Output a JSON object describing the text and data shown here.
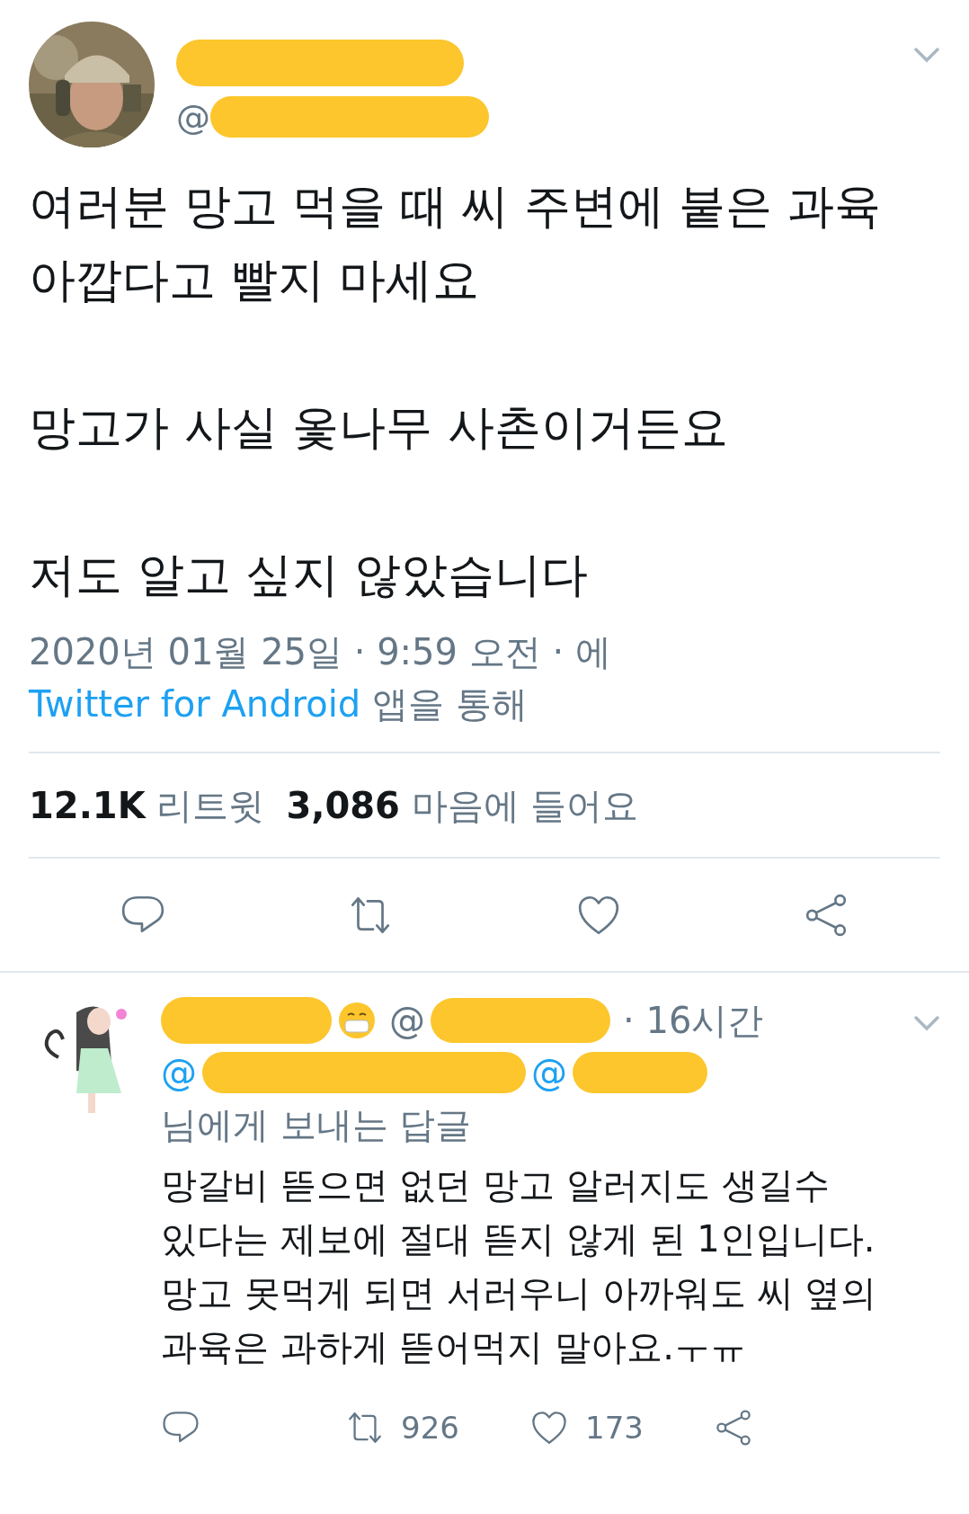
{
  "tweet": {
    "author": {
      "handle_prefix": "@"
    },
    "paragraphs": [
      "여러분 망고 먹을 때 씨 주변에 붙은 과육 아깝다고 빨지 마세요",
      "망고가 사실 옻나무 사촌이거든요",
      "저도 알고 싶지 않았습니다"
    ],
    "meta": {
      "time": "2020년 01월 25일 · 9:59 오전 · 에 ",
      "source": "Twitter for Android",
      "suffix": " 앱을 통해"
    },
    "stats": [
      {
        "count": "12.1K",
        "label": "리트윗"
      },
      {
        "count": "3,086",
        "label": "마음에 들어요"
      }
    ],
    "actions": [
      {
        "kind": "reply"
      },
      {
        "kind": "retweet"
      },
      {
        "kind": "like"
      },
      {
        "kind": "share"
      }
    ]
  },
  "reply": {
    "handle_prefix": "@",
    "time": "· 16시간",
    "mentions": [
      "@",
      "@"
    ],
    "reply_to_suffix": "님에게 보내는 답글",
    "text": "망갈비 뜯으면 없던 망고 알러지도 생길수 있다는 제보에 절대 뜯지 않게 된 1인입니다. 망고 못먹게 되면 서러우니 아까워도 씨 옆의 과육은 과하게 뜯어먹지 말아요.ㅜㅠ",
    "actions": [
      {
        "kind": "reply"
      },
      {
        "kind": "retweet",
        "count": "926"
      },
      {
        "kind": "like",
        "count": "173"
      },
      {
        "kind": "share"
      }
    ]
  }
}
